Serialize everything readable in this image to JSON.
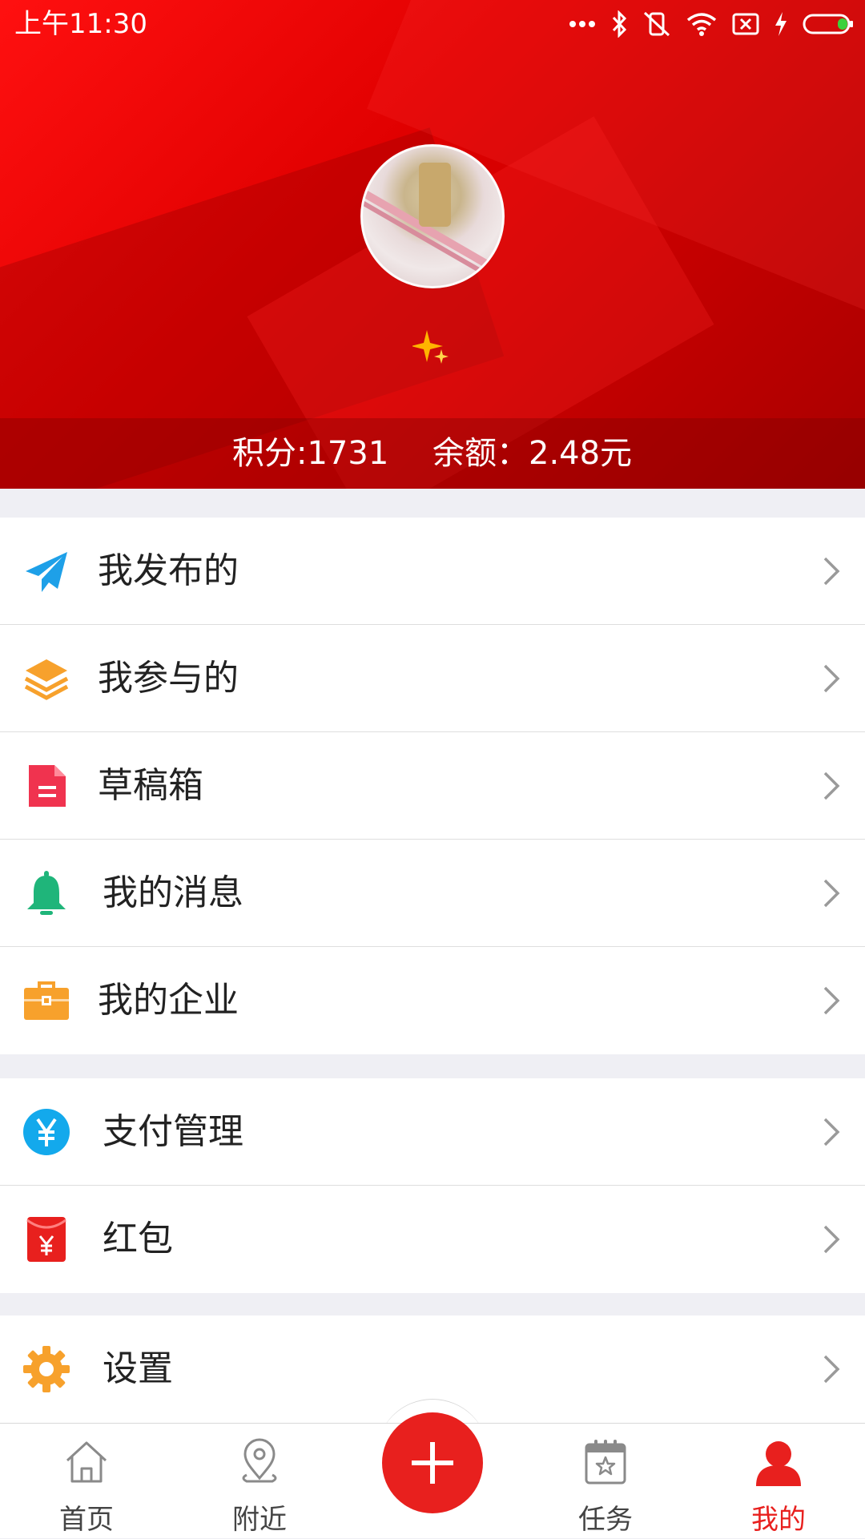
{
  "status_bar": {
    "time": "上午11:30",
    "icons": [
      "more-dots-icon",
      "bluetooth-icon",
      "vibrate-off-icon",
      "wifi-icon",
      "sim-off-icon",
      "charging-icon",
      "battery-icon"
    ]
  },
  "profile": {
    "avatar": "avatar",
    "level_icon": "sparkle-icon",
    "points_text": "积分:1731",
    "balance_text": "余额：2.48元"
  },
  "menu": {
    "group1": [
      {
        "label": "我发布的",
        "icon": "paper-plane-icon",
        "color": "#1ea0e8"
      },
      {
        "label": "我参与的",
        "icon": "layers-icon",
        "color": "#f7a12c"
      },
      {
        "label": "草稿箱",
        "icon": "document-icon",
        "color": "#f0334f"
      },
      {
        "label": "我的消息",
        "icon": "bell-icon",
        "color": "#1fb57a"
      },
      {
        "label": "我的企业",
        "icon": "briefcase-icon",
        "color": "#f7a12c"
      }
    ],
    "group2": [
      {
        "label": "支付管理",
        "icon": "yuan-icon",
        "color": "#13a9ec"
      },
      {
        "label": "红包",
        "icon": "red-envelope-icon",
        "color": "#e8201e"
      }
    ],
    "group3": [
      {
        "label": "设置",
        "icon": "gear-icon",
        "color": "#f7a12c"
      }
    ]
  },
  "tabbar": {
    "home": "首页",
    "nearby": "附近",
    "add": "add-icon",
    "tasks": "任务",
    "mine": "我的",
    "active": "我的",
    "accent": "#e8201e"
  }
}
